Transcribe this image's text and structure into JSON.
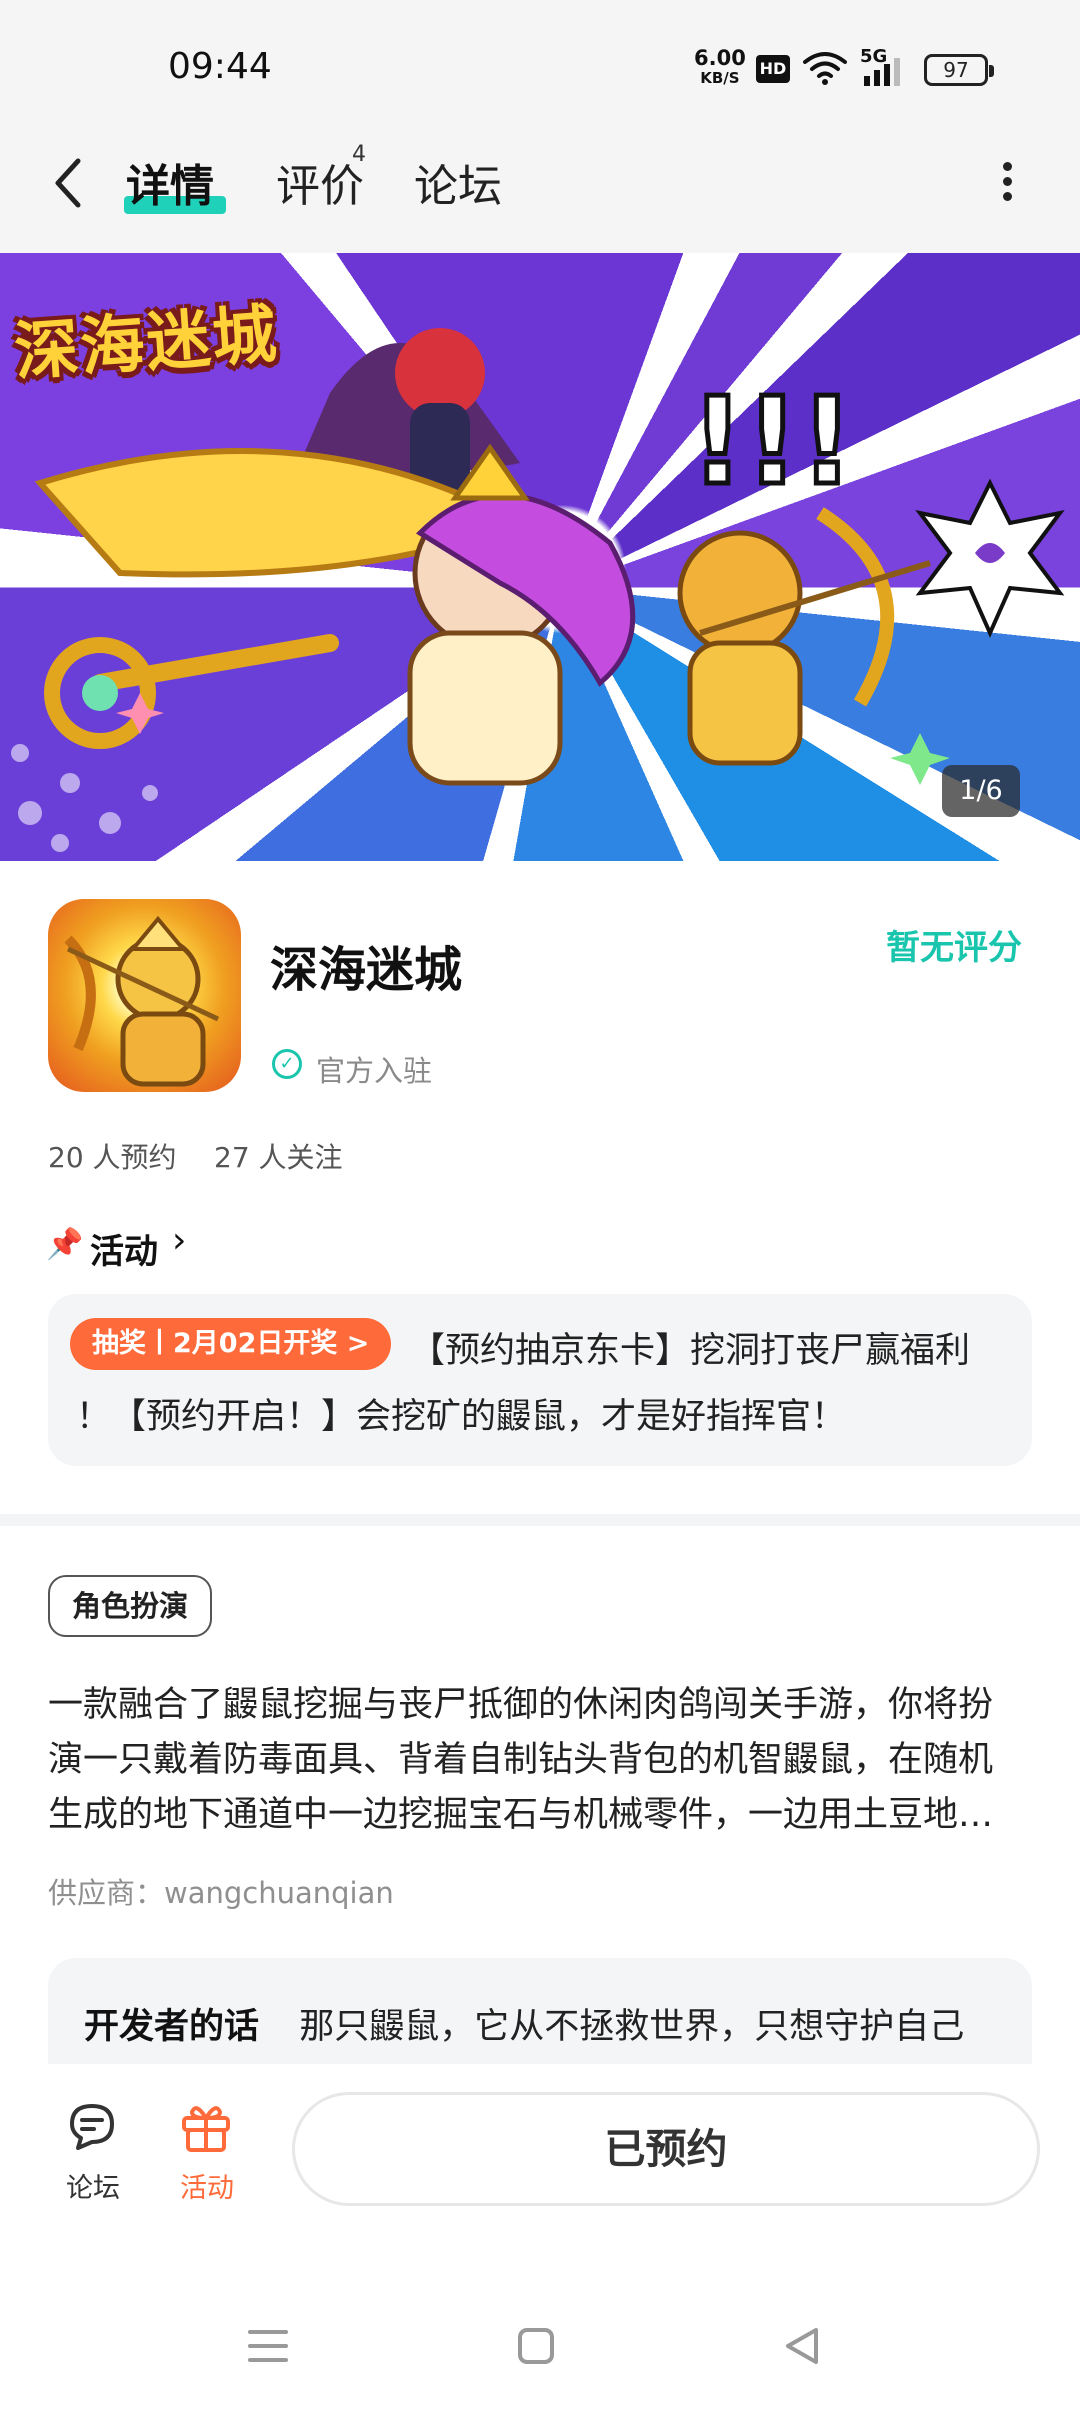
{
  "status_bar": {
    "time": "09:44",
    "net_speed_value": "6.00",
    "net_speed_unit": "KB/S",
    "hd_label": "HD",
    "signal_label": "5G",
    "battery": "97"
  },
  "header": {
    "tabs": [
      {
        "label": "详情",
        "active": true
      },
      {
        "label": "评价",
        "badge": "4"
      },
      {
        "label": "论坛"
      }
    ]
  },
  "banner": {
    "logo_text": "深海迷城",
    "counter": "1/6"
  },
  "app": {
    "name": "深海迷城",
    "official_label": "官方入驻",
    "rating_text": "暂无评分",
    "reservations": "20 人预约",
    "followers": "27 人关注"
  },
  "activity": {
    "section_title": "活动",
    "badge": "抽奖丨2月02日开奖 >",
    "text_line1": "【预约抽京东卡】挖洞打丧尸赢福利",
    "text_line2": "！【预约开启！】会挖矿的鼹鼠，才是好指挥官！"
  },
  "details": {
    "genre_tag": "角色扮演",
    "description_lines": [
      "一款融合了鼹鼠挖掘与丧尸抵御的休闲肉鸽闯关手游，你将扮",
      "演一只戴着防毒面具、背着自制钻头背包的机智鼹鼠，在随机",
      "生成的地下通道中一边挖掘宝石与机械零件，一边用土豆地…"
    ],
    "supplier": "供应商：wangchuanqian",
    "developer_label": "开发者的话",
    "developer_text": "那只鼹鼠，它从不拯救世界，只想守护自己"
  },
  "bottom_bar": {
    "forum_label": "论坛",
    "activity_label": "活动",
    "reserve_button": "已预约"
  },
  "colors": {
    "accent": "#1fd1b8",
    "orange": "#ff6a3a"
  }
}
